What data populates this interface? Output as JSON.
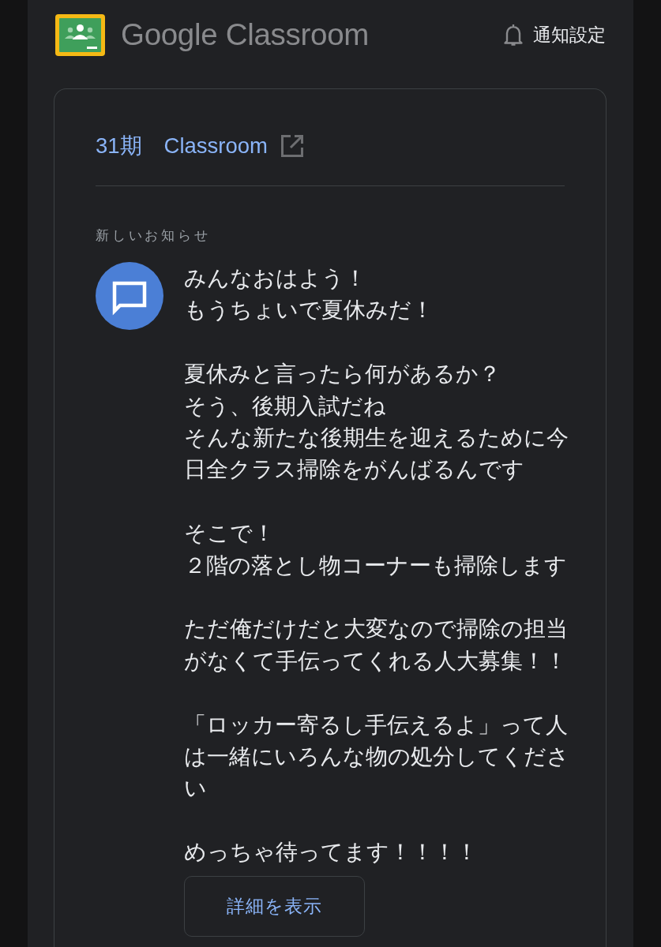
{
  "header": {
    "logo_text": "Google Classroom",
    "notification_settings": "通知設定"
  },
  "card": {
    "class_link": "31期　Classroom",
    "section_label": "新しいお知らせ",
    "announcement": {
      "paragraphs": [
        [
          "みんなおはよう！",
          "もうちょいで夏休みだ！"
        ],
        [
          "夏休みと言ったら何があるか？",
          "そう、後期入試だね",
          "そんな新たな後期生を迎えるために今日全クラス掃除をがんばるんです"
        ],
        [
          "そこで！",
          "２階の落とし物コーナーも掃除します"
        ],
        [
          "ただ俺だけだと大変なので掃除の担当がなくて手伝ってくれる人大募集！！"
        ],
        [
          "「ロッカー寄るし手伝えるよ」って人は一緒にいろんな物の処分してください"
        ],
        [
          "めっちゃ待ってます！！！！"
        ]
      ]
    },
    "details_button": "詳細を表示"
  }
}
